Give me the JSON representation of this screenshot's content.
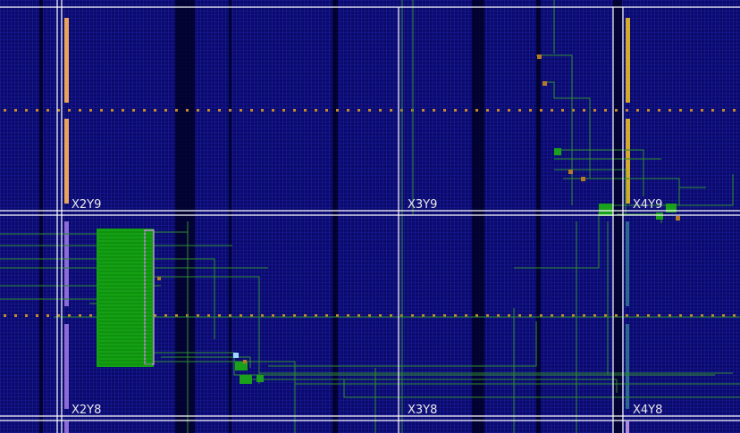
{
  "view": {
    "kind": "FPGA device floorplan",
    "colors": {
      "background": "#000000",
      "grid_fabric": "#0c0c7a",
      "grid_line": "#2a2ab4",
      "clock_region_border": "#ffffff",
      "placed_logic": "#19a619",
      "routing_net": "#2f8f2f",
      "bram_column": "#e9a35f",
      "dsp_column": "#8c6bd6",
      "io_column": "#d4aa2a",
      "pin_marker": "#b57a29",
      "selected_cell": "#9fd8ff",
      "clock_spine_dot": "#c58a2c"
    }
  },
  "clock_regions": [
    {
      "id": "x2y9",
      "label": "X2Y9"
    },
    {
      "id": "x3y9",
      "label": "X3Y9"
    },
    {
      "id": "x4y9",
      "label": "X4Y9"
    },
    {
      "id": "x2y8",
      "label": "X2Y8"
    },
    {
      "id": "x3y8",
      "label": "X3Y8"
    },
    {
      "id": "x4y8",
      "label": "X4Y8"
    }
  ]
}
